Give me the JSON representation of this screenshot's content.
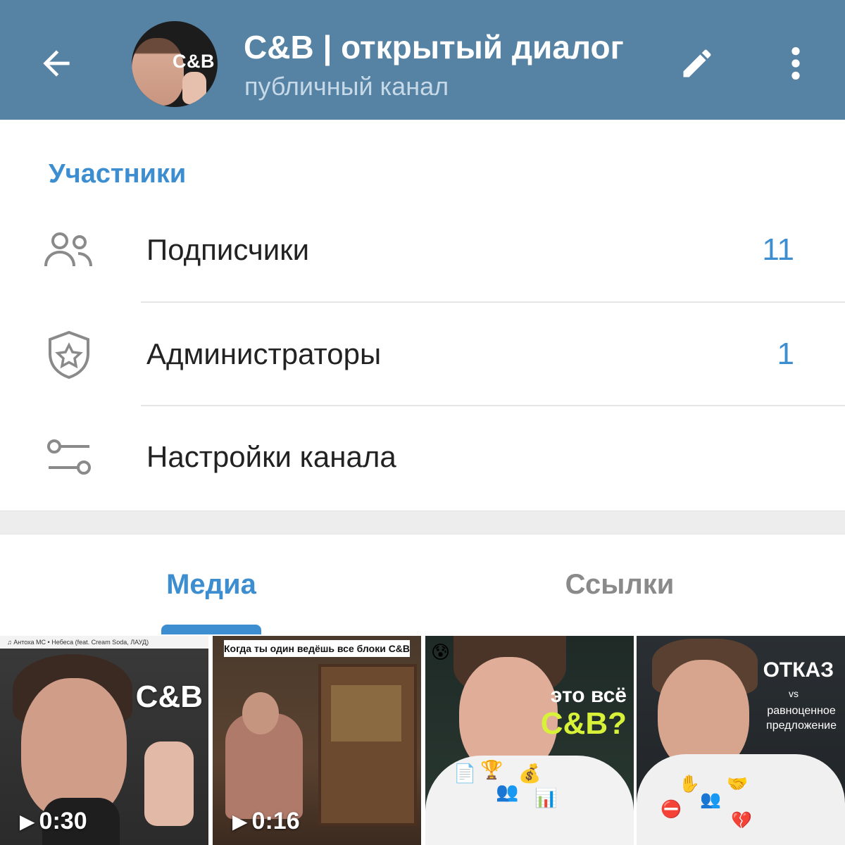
{
  "header": {
    "title": "C&B | открытый диалог",
    "subtitle": "публичный канал",
    "avatar_badge": "C&B",
    "back_icon": "arrow-left-icon",
    "edit_icon": "pencil-icon",
    "more_icon": "more-vertical-icon",
    "background_color": "#5682a3"
  },
  "members": {
    "section_title": "Участники",
    "rows": [
      {
        "label": "Подписчики",
        "count": "11",
        "icon": "people-icon"
      },
      {
        "label": "Администраторы",
        "count": "1",
        "icon": "shield-star-icon"
      },
      {
        "label": "Настройки канала",
        "count": "",
        "icon": "settings-toggles-icon"
      }
    ]
  },
  "tabs": [
    {
      "label": "Медиа",
      "active": true
    },
    {
      "label": "Ссылки",
      "active": false
    }
  ],
  "media": [
    {
      "duration": "0:30",
      "music_bar": "♫ Антоха МС • Небеса (feat. Cream Soda, ЛАУД)",
      "overlay": "C&B"
    },
    {
      "duration": "0:16",
      "caption": "Когда ты один ведёшь все блоки C&B"
    },
    {
      "duration": "",
      "overlay_line1": "это всё",
      "overlay_line2": "C&B?"
    },
    {
      "duration": "",
      "overlay_line1": "ОТКАЗ",
      "overlay_vs": "vs",
      "overlay_line2": "равноценное",
      "overlay_line3": "предложение"
    }
  ],
  "colors": {
    "accent": "#3d8ed0",
    "header": "#5682a3"
  }
}
